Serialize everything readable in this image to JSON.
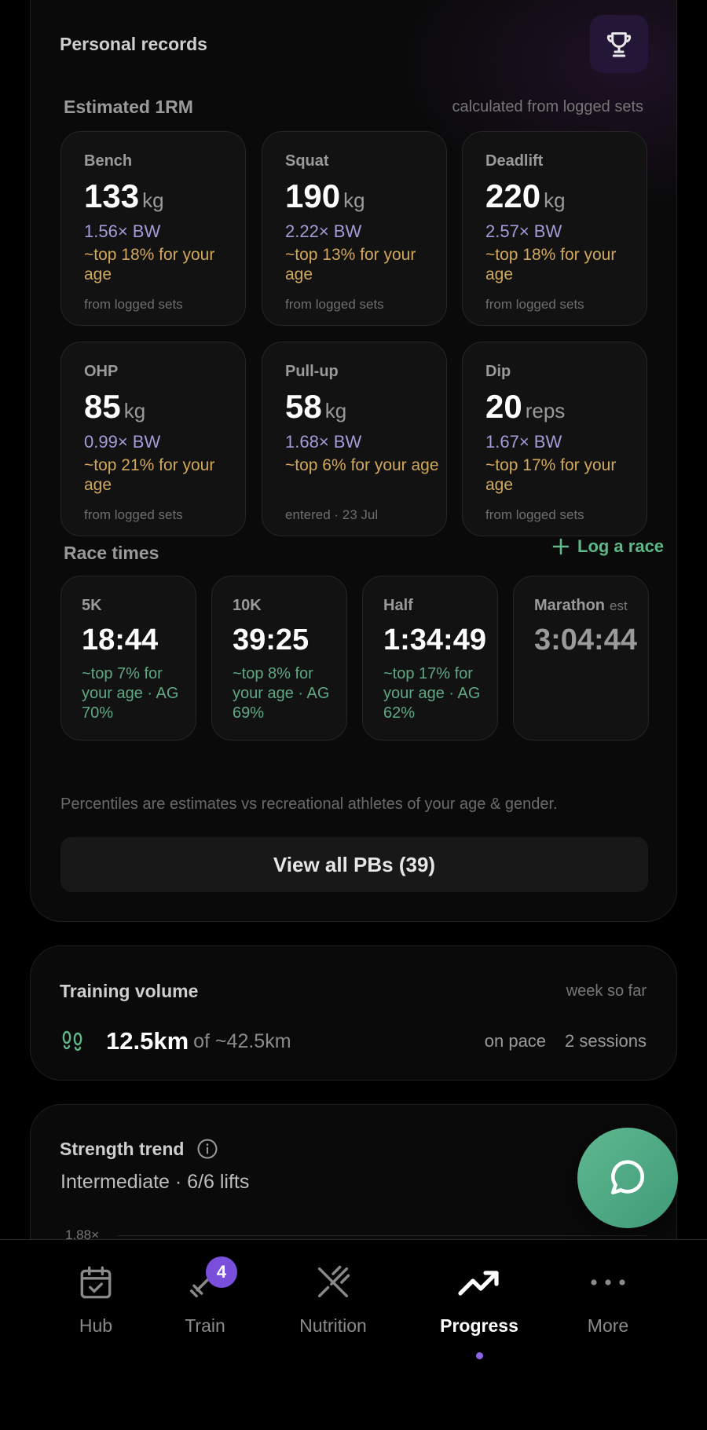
{
  "personal_records": {
    "title": "Personal records",
    "icon": "trophy-icon",
    "one_rm": {
      "label": "Estimated 1RM",
      "note": "calculated from logged sets",
      "lifts": [
        {
          "name": "Bench",
          "value": "133",
          "unit": "kg",
          "bw": "1.56× BW",
          "percentile": "~top 18% for your age",
          "source": "from logged sets"
        },
        {
          "name": "Squat",
          "value": "190",
          "unit": "kg",
          "bw": "2.22× BW",
          "percentile": "~top 13% for your age",
          "source": "from logged sets"
        },
        {
          "name": "Deadlift",
          "value": "220",
          "unit": "kg",
          "bw": "2.57× BW",
          "percentile": "~top 18% for your age",
          "source": "from logged sets"
        },
        {
          "name": "OHP",
          "value": "85",
          "unit": "kg",
          "bw": "0.99× BW",
          "percentile": "~top 21% for your age",
          "source": "from logged sets"
        },
        {
          "name": "Pull-up",
          "value": "58",
          "unit": "kg",
          "bw": "1.68× BW",
          "percentile": "~top 6% for your age",
          "source": "entered · 23 Jul"
        },
        {
          "name": "Dip",
          "value": "20",
          "unit": "reps",
          "bw": "1.67× BW",
          "percentile": "~top 17% for your age",
          "source": "from logged sets"
        }
      ]
    },
    "races": {
      "label": "Race times",
      "log_label": "Log a race",
      "items": [
        {
          "name": "5K",
          "time": "18:44",
          "detail": "~top 7% for your age · AG 70%"
        },
        {
          "name": "10K",
          "time": "39:25",
          "detail": "~top 8% for your age · AG 69%"
        },
        {
          "name": "Half",
          "time": "1:34:49",
          "detail": "~top 17% for your age · AG 62%"
        },
        {
          "name": "Marathon",
          "est": "est",
          "time": "3:04:44",
          "detail": ""
        }
      ]
    },
    "disclaimer": "Percentiles are estimates vs recreational athletes of your age & gender.",
    "view_all_label": "View all PBs (39)"
  },
  "training_volume": {
    "title": "Training volume",
    "period": "week so far",
    "icon": "footprints-icon",
    "distance": "12.5km",
    "target": "of ~42.5km",
    "pace": "on pace",
    "sessions": "2 sessions"
  },
  "strength_trend": {
    "title": "Strength trend",
    "subtitle": "Intermediate · 6/6 lifts",
    "axis_tick": "1.88×"
  },
  "colors": {
    "accent_green": "#5fb888",
    "accent_purple": "#7a4fdc",
    "gold": "#d1a85a",
    "lavender": "#a69bd8"
  },
  "tabbar": {
    "tabs": [
      {
        "label": "Hub",
        "icon": "calendar-check-icon"
      },
      {
        "label": "Train",
        "icon": "dumbbell-icon"
      },
      {
        "label": "Nutrition",
        "icon": "fork-knife-icon"
      },
      {
        "label": "Progress",
        "icon": "trending-up-icon"
      },
      {
        "label": "More",
        "icon": "more-dots-icon"
      }
    ],
    "train_badge": "4",
    "active": "Progress"
  }
}
